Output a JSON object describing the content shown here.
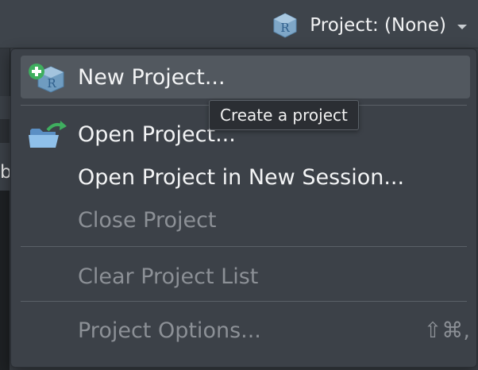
{
  "toolbar": {
    "project_label": "Project: (None)",
    "project_icon": "r-project-icon"
  },
  "background": {
    "left_letter": "b"
  },
  "menu": {
    "items": [
      {
        "label": "New Project...",
        "icon": "new-project-icon",
        "enabled": true,
        "highlighted": true
      },
      {
        "label": "Open Project...",
        "icon": "open-folder-icon",
        "enabled": true
      },
      {
        "label": "Open Project in New Session...",
        "enabled": true
      },
      {
        "label": "Close Project",
        "enabled": false
      },
      {
        "label": "Clear Project List",
        "enabled": false
      },
      {
        "label": "Project Options...",
        "enabled": false,
        "shortcut": "⇧⌘,"
      }
    ]
  },
  "tooltip": {
    "text": "Create a project"
  },
  "colors": {
    "menu_bg": "#3c4148",
    "highlight_bg": "#52585f",
    "enabled_text": "#f3f4f5",
    "disabled_text": "#8c9096",
    "tooltip_bg": "#2b2e33"
  }
}
